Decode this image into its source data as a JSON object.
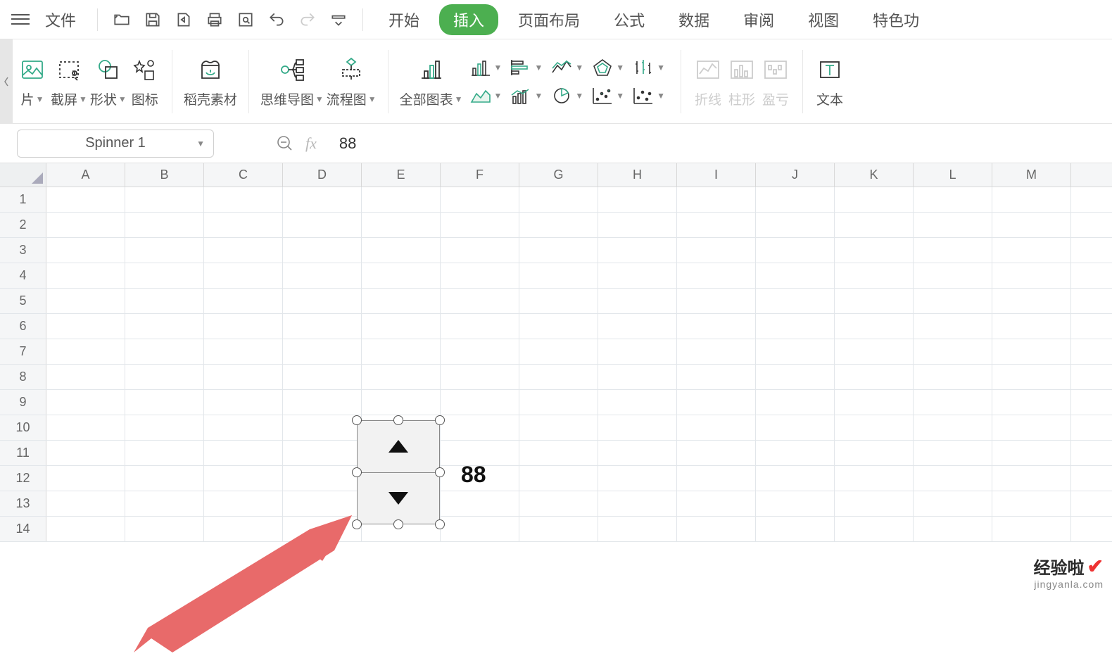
{
  "menu": {
    "file": "文件"
  },
  "tabs": {
    "start": "开始",
    "insert": "插入",
    "layout": "页面布局",
    "formula": "公式",
    "data": "数据",
    "review": "审阅",
    "view": "视图",
    "special": "特色功"
  },
  "ribbon": {
    "pictures": "片",
    "screenshot": "截屏",
    "shapes": "形状",
    "icons": "图标",
    "material": "稻壳素材",
    "mindmap": "思维导图",
    "flowchart": "流程图",
    "allcharts": "全部图表",
    "sparkline_line": "折线",
    "sparkline_col": "柱形",
    "sparkline_wl": "盈亏",
    "textbox": "文本"
  },
  "namebox": "Spinner 1",
  "formula_value": "88",
  "columns": [
    "A",
    "B",
    "C",
    "D",
    "E",
    "F",
    "G",
    "H",
    "I",
    "J",
    "K",
    "L",
    "M"
  ],
  "rows": [
    "1",
    "2",
    "3",
    "4",
    "5",
    "6",
    "7",
    "8",
    "9",
    "10",
    "11",
    "12",
    "13",
    "14"
  ],
  "cell_value_f4": "88",
  "watermark": {
    "title": "经验啦",
    "sub": "jingyanla.com"
  }
}
